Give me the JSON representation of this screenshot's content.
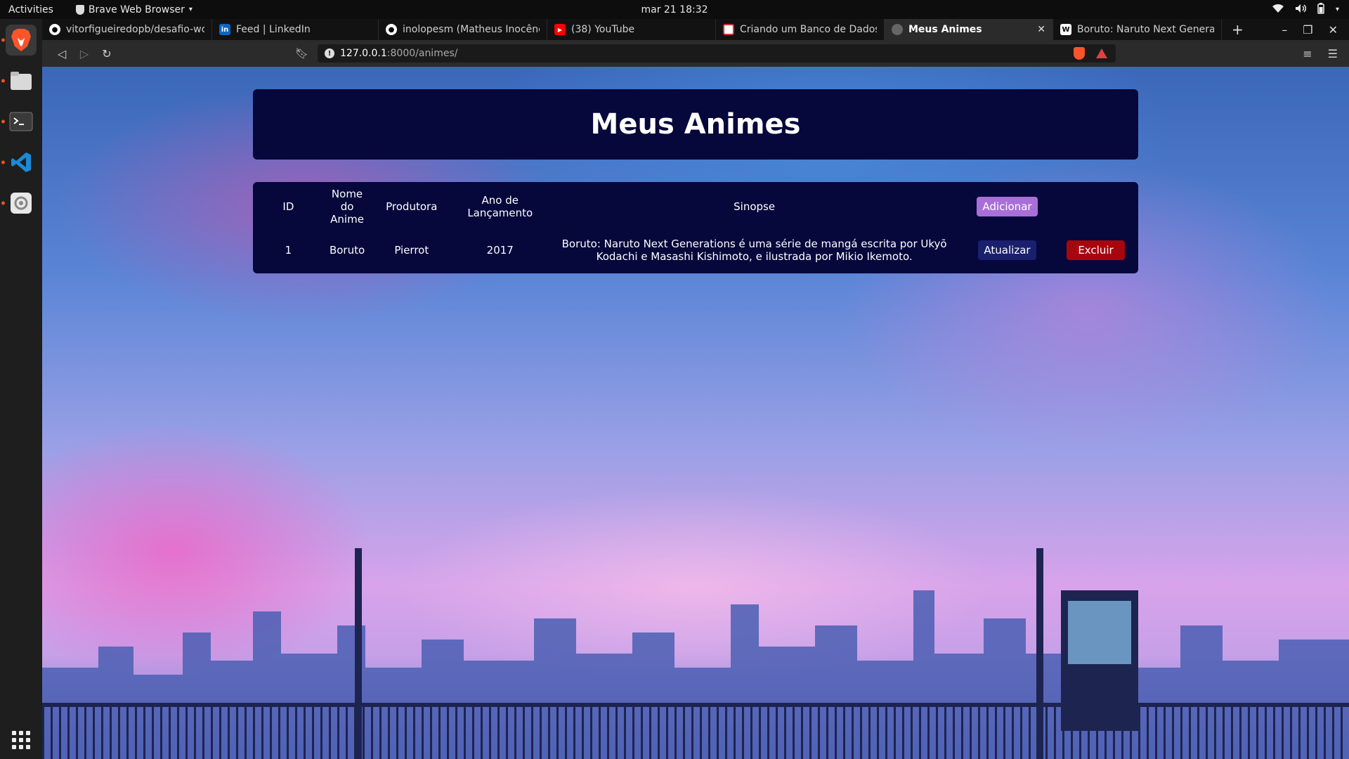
{
  "os": {
    "activities": "Activities",
    "app_name": "Brave Web Browser",
    "clock": "mar 21  18:32"
  },
  "browser": {
    "tabs": [
      {
        "title": "vitorfigueiredopb/desafio-wc",
        "icon": "github-icon"
      },
      {
        "title": "Feed | LinkedIn",
        "icon": "linkedin-icon"
      },
      {
        "title": "inolopesm (Matheus Inocênci",
        "icon": "github-icon"
      },
      {
        "title": "(38) YouTube",
        "icon": "youtube-icon"
      },
      {
        "title": "Criando um Banco de Dados n",
        "icon": "page-icon"
      },
      {
        "title": "Meus Animes",
        "icon": "globe-icon",
        "active": true
      },
      {
        "title": "Boruto: Naruto Next Generat",
        "icon": "wikipedia-icon"
      }
    ],
    "url_host": "127.0.0.1",
    "url_path": ":8000/animes/"
  },
  "page": {
    "title": "Meus Animes",
    "table": {
      "headers": {
        "id": "ID",
        "nome": "Nome do Anime",
        "produtora": "Produtora",
        "ano": "Ano de Lançamento",
        "sinopse": "Sinopse"
      },
      "add_label": "Adicionar",
      "rows": [
        {
          "id": "1",
          "nome": "Boruto",
          "produtora": "Pierrot",
          "ano": "2017",
          "sinopse": "Boruto: Naruto Next Generations é uma série de mangá escrita por Ukyō Kodachi e Masashi Kishimoto, e ilustrada por Mikio Ikemoto.",
          "update_label": "Atualizar",
          "delete_label": "Excluir"
        }
      ]
    }
  },
  "colors": {
    "card_bg": "#06073b",
    "add_button": "#a96fd9",
    "update_button": "#1a1f6e",
    "delete_button": "#a8060e"
  }
}
